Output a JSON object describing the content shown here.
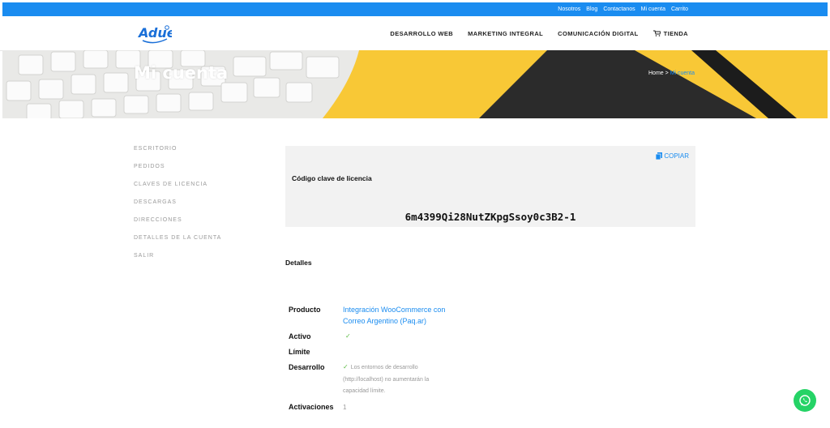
{
  "topbar": {
    "links": [
      "Nosotros",
      "Blog",
      "Contactanos",
      "Mi cuenta",
      "Carrito"
    ]
  },
  "header": {
    "logo_text": "Adue",
    "nav": [
      "DESARROLLO WEB",
      "MARKETING INTEGRAL",
      "COMUNICACIÓN DIGITAL",
      "TIENDA"
    ],
    "cart_icon": "cart-icon"
  },
  "hero": {
    "title": "Mi cuenta",
    "breadcrumb_home": "Home",
    "breadcrumb_sep": " > ",
    "breadcrumb_current": "Mi cuenta"
  },
  "sidebar": {
    "items": [
      "ESCRITORIO",
      "PEDIDOS",
      "CLAVES DE LICENCIA",
      "DESCARGAS",
      "DIRECCIONES",
      "DETALLES DE LA CUENTA",
      "SALIR"
    ]
  },
  "license": {
    "copy_label": "COPIAR",
    "copy_icon": "copy-icon",
    "label": "Código clave de licencia",
    "key": "6m4399Qi28NutZKpgSsoy0c3B2-1"
  },
  "details": {
    "title": "Detalles",
    "producto_label": "Producto",
    "producto_value_line1": "Integración WooCommerce con",
    "producto_value_line2": "Correo Argentino (Paq.ar)",
    "activo_label": "Activo",
    "limite_label": "Límite",
    "desarrollo_label": "Desarrollo",
    "desarrollo_line1": "Los entornos de desarrollo",
    "desarrollo_line2": "(http://localhost) no aumentarán la",
    "desarrollo_line3": "capacidad límite.",
    "activaciones_label": "Activaciones",
    "activaciones_value": "1"
  },
  "colors": {
    "accent": "#1a8cf0",
    "hero_yellow": "#f8c836",
    "check_green": "#5dbb46",
    "whatsapp": "#25d366"
  },
  "floating": {
    "whatsapp_icon": "whatsapp-icon"
  }
}
